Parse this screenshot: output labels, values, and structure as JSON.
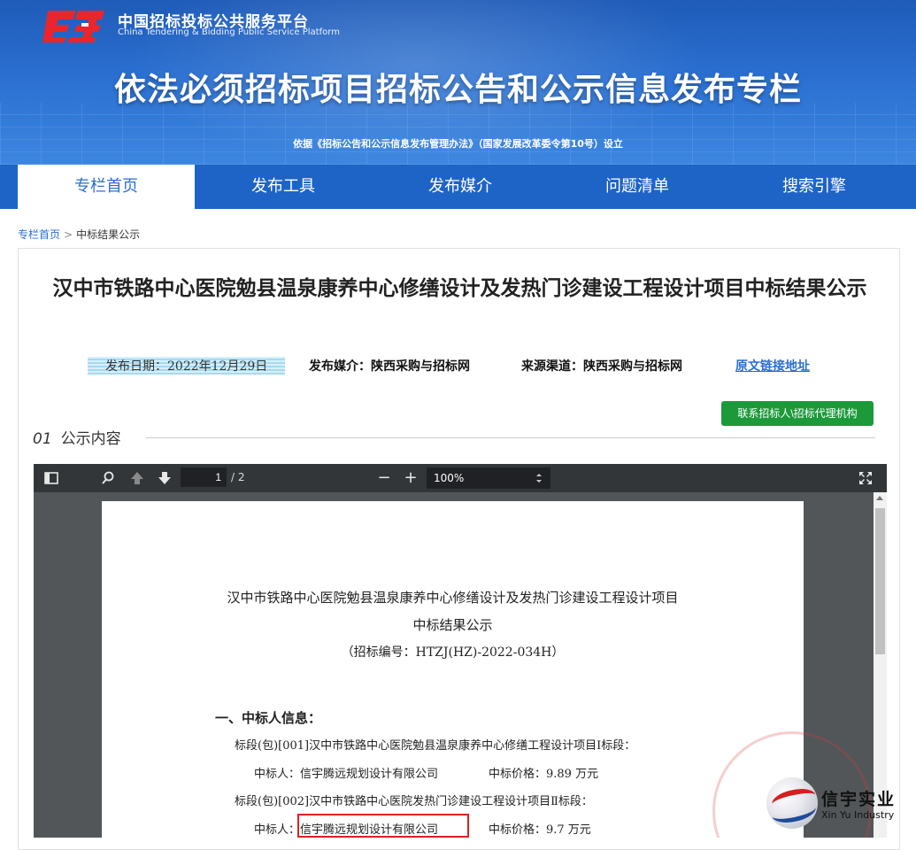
{
  "header": {
    "site_name_cn": "中国招标投标公共服务平台",
    "site_name_en": "China Tendering & Bidding Public Service Platform",
    "banner_title": "依法必须招标项目招标公告和公示信息发布专栏",
    "banner_subtitle": "依据《招标公告和公示信息发布管理办法》（国家发展改革委令第10号）设立"
  },
  "nav": {
    "items": [
      {
        "label": "专栏首页",
        "active": true
      },
      {
        "label": "发布工具",
        "active": false
      },
      {
        "label": "发布媒介",
        "active": false
      },
      {
        "label": "问题清单",
        "active": false
      },
      {
        "label": "搜索引擎",
        "active": false
      }
    ]
  },
  "breadcrumb": {
    "home": "专栏首页",
    "separator": ">",
    "current": "中标结果公示"
  },
  "article": {
    "title": "汉中市铁路中心医院勉县温泉康养中心修缮设计及发热门诊建设工程设计项目中标结果公示",
    "publish_date": "发布日期：2022年12月29日",
    "media": "发布媒介：陕西采购与招标网",
    "source": "来源渠道：陕西采购与招标网",
    "original_link": "原文链接地址",
    "contact_button": "联系招标人\\招标代理机构",
    "section_number": "01",
    "section_title": "公示内容"
  },
  "pdf_viewer": {
    "current_page": "1",
    "total_pages": "/ 2",
    "zoom": "100%",
    "minus": "−",
    "plus": "+"
  },
  "document": {
    "title_line1": "汉中市铁路中心医院勉县温泉康养中心修缮设计及发热门诊建设工程设计项目",
    "title_line2": "中标结果公示",
    "code": "（招标编号：HTZJ(HZ)-2022-034H）",
    "section1": "一、中标人信息：",
    "lot1_desc": "标段(包)[001]汉中市铁路中心医院勉县温泉康养中心修缮工程设计项目Ⅰ标段：",
    "lot1_winner": "中标人：信宇腾远规划设计有限公司",
    "lot1_price": "中标价格：9.89 万元",
    "lot2_desc": "标段(包)[002]汉中市铁路中心医院发热门诊建设工程设计项目Ⅱ标段：",
    "lot2_winner": "中标人：信宇腾远规划设计有限公司",
    "lot2_price": "中标价格：9.7 万元"
  },
  "watermark": {
    "name_cn": "信宇实业",
    "name_en": "Xin Yu Industry"
  },
  "colors": {
    "nav_blue": "#1e64c6",
    "link_blue": "#2a6fd0",
    "button_green": "#1c9a3a",
    "highlight_red": "#e02020"
  }
}
